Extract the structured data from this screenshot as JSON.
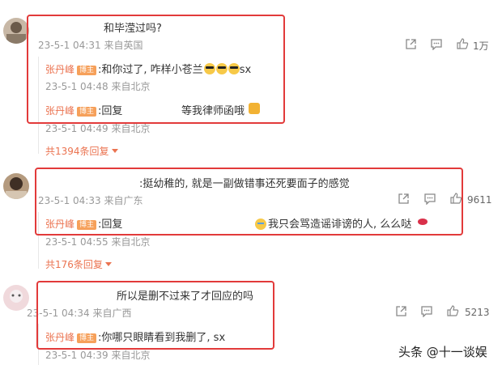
{
  "comments": [
    {
      "text": "和毕滢过吗?",
      "time": "23-5-1 04:31",
      "location": "来自英国",
      "likes": "1万",
      "replies": [
        {
          "name": "张丹峰",
          "badge": "博主",
          "text": ":和你过了, 咋样小苍兰",
          "tail": "sx",
          "time": "23-5-1 04:48",
          "location": "来自北京"
        },
        {
          "name": "张丹峰",
          "badge": "博主",
          "text": ":回复",
          "tail": "等我律师函哦",
          "time": "23-5-1 04:49",
          "location": "来自北京"
        }
      ],
      "more": "共1394条回复"
    },
    {
      "text": ":挺幼稚的, 就是一副做错事还死要面子的感觉",
      "time": "23-5-1 04:33",
      "location": "来自广东",
      "likes": "9611",
      "replies": [
        {
          "name": "张丹峰",
          "badge": "博主",
          "text": ":回复",
          "tail": "我只会骂造谣诽谤的人, 么么哒",
          "time": "23-5-1 04:55",
          "location": "来自北京"
        }
      ],
      "more": "共176条回复"
    },
    {
      "text": "所以是删不过来了才回应的吗",
      "time": "23-5-1 04:34",
      "location": "来自广西",
      "likes": "5213",
      "replies": [
        {
          "name": "张丹峰",
          "badge": "博主",
          "text": ":你哪只眼睛看到我删了, sx",
          "time": "23-5-1 04:39",
          "location": "来自北京"
        }
      ]
    }
  ],
  "watermark": "头条 @十一谈娱",
  "icons": [
    "share-icon",
    "comment-icon",
    "like-icon"
  ],
  "colors": {
    "highlight": "#e23a3a",
    "name": "#eb7350",
    "badge": "#f6a05a"
  }
}
